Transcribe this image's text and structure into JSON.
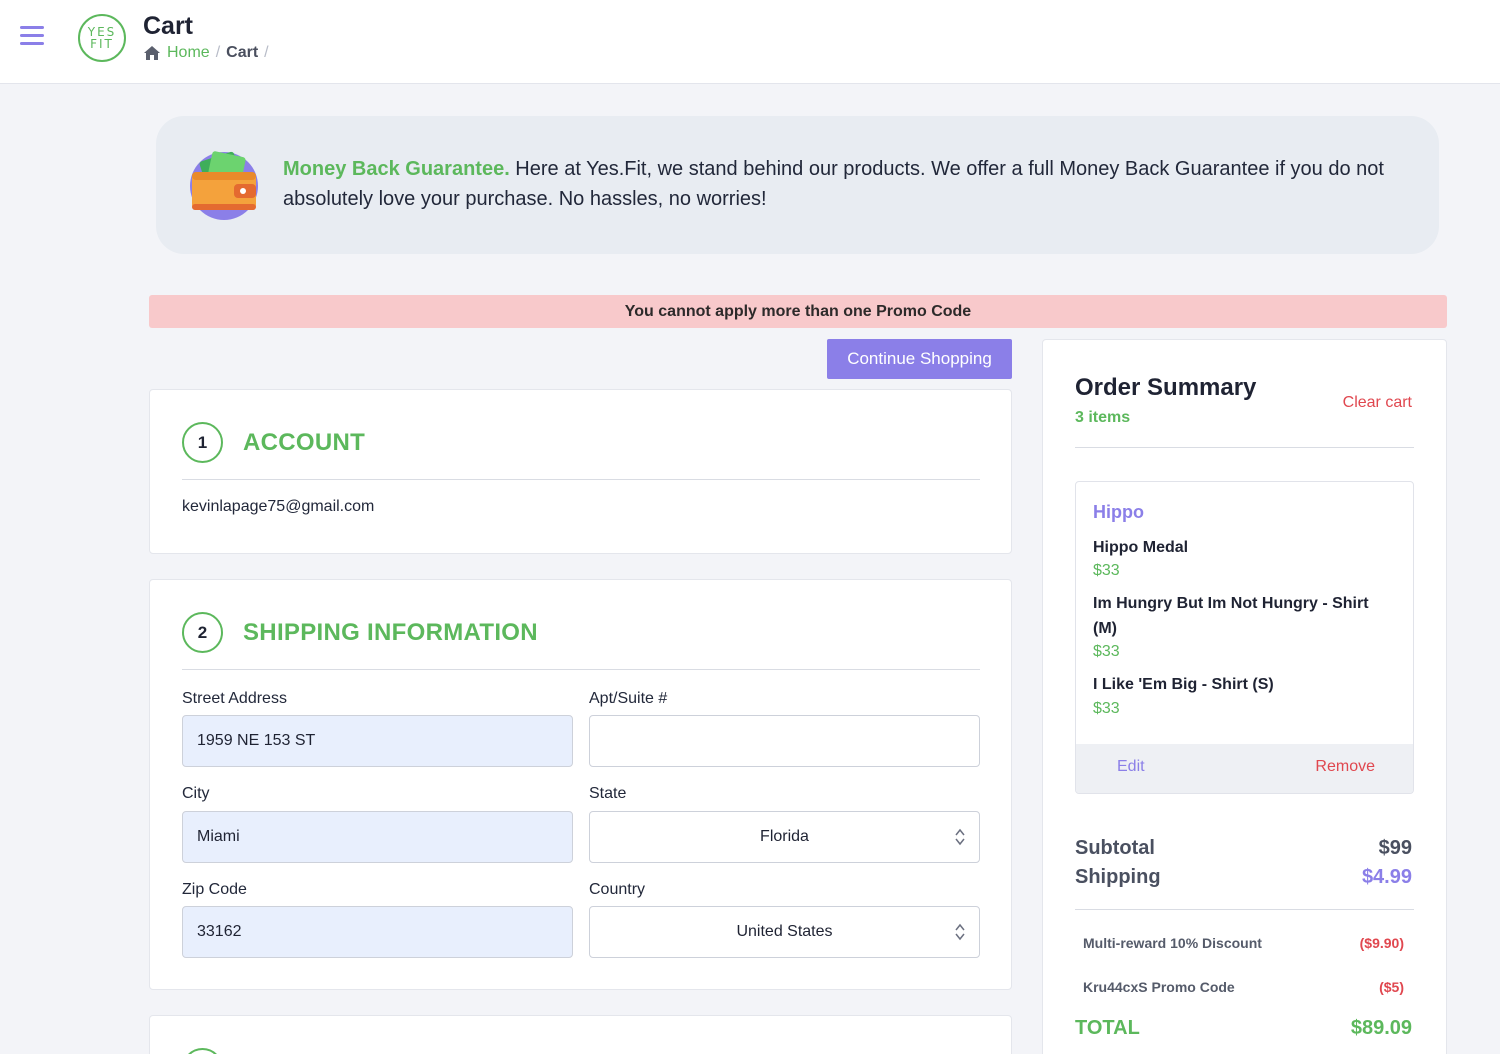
{
  "header": {
    "logo_top": "YES",
    "logo_bottom": "FIT",
    "title": "Cart",
    "breadcrumb": {
      "home": "Home",
      "separator": "/",
      "current": "Cart"
    }
  },
  "guarantee": {
    "highlight": "Money Back Guarantee.",
    "text": " Here at Yes.Fit, we stand behind our products. We offer a full Money Back Guarantee if you do not absolutely love your purchase. No hassles, no worries!"
  },
  "alert": {
    "message": "You cannot apply more than one Promo Code"
  },
  "continue_label": "Continue Shopping",
  "account": {
    "number": "1",
    "title": "ACCOUNT",
    "email": "kevinlapage75@gmail.com"
  },
  "shipping": {
    "number": "2",
    "title": "SHIPPING INFORMATION",
    "street_label": "Street Address",
    "street_value": "1959 NE 153 ST",
    "apt_label": "Apt/Suite #",
    "apt_value": "",
    "city_label": "City",
    "city_value": "Miami",
    "state_label": "State",
    "state_value": "Florida",
    "zip_label": "Zip Code",
    "zip_value": "33162",
    "country_label": "Country",
    "country_value": "United States"
  },
  "summary": {
    "title": "Order Summary",
    "items_count": "3 items",
    "clear_label": "Clear cart",
    "brand": "Hippo",
    "items": [
      {
        "name": "Hippo Medal",
        "price": "$33"
      },
      {
        "name": "Im Hungry But Im Not Hungry - Shirt (M)",
        "price": "$33"
      },
      {
        "name": "I Like 'Em Big - Shirt (S)",
        "price": "$33"
      }
    ],
    "edit_label": "Edit",
    "remove_label": "Remove",
    "subtotal_label": "Subtotal",
    "subtotal_value": "$99",
    "shipping_label": "Shipping",
    "shipping_value": "$4.99",
    "discount_label": "Multi-reward 10% Discount",
    "discount_value": "($9.90)",
    "promo_label": "Kru44cxS Promo Code",
    "promo_value": "($5)",
    "total_label": "TOTAL",
    "total_value": "$89.09"
  },
  "colors": {
    "accent_purple": "#8b7fe8",
    "brand_green": "#5cb85c",
    "danger_red": "#e0474f",
    "alert_bg": "#f8c9cb",
    "filled_input_bg": "#e8effd"
  },
  "icons": [
    "menu-icon",
    "yesfit-logo",
    "home-icon",
    "wallet-icon",
    "select-caret-icon"
  ]
}
